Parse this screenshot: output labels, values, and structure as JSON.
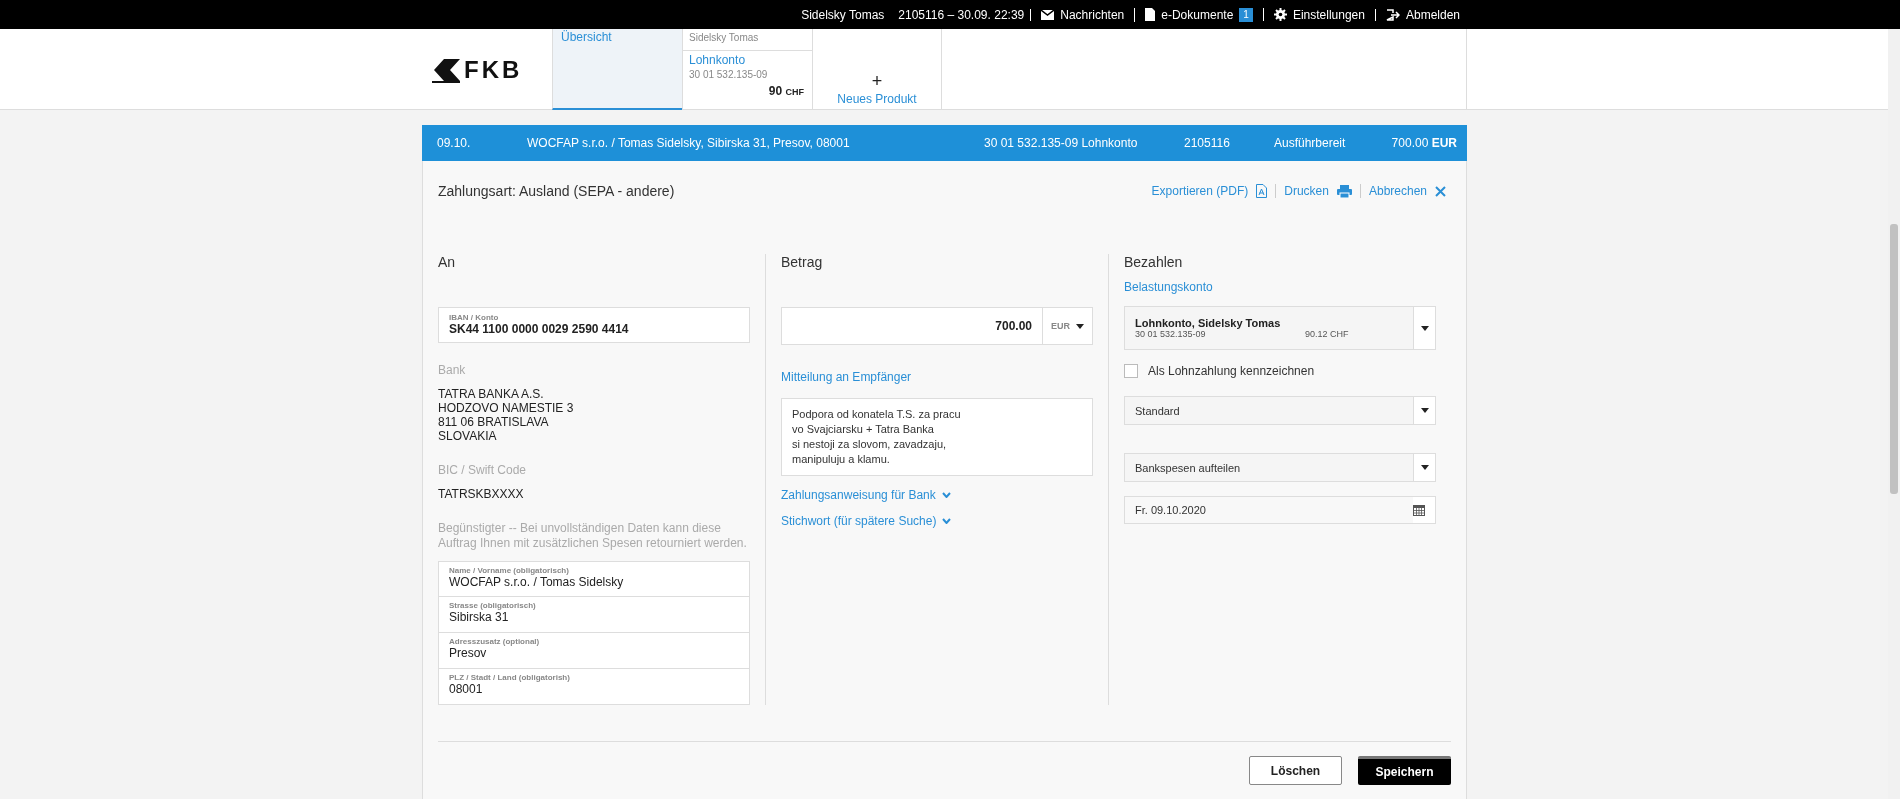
{
  "top_bar": {
    "user": "Sidelsky Tomas",
    "session": "2105116 – 30.09. 22:39",
    "links": [
      {
        "kind": "mail",
        "label": "Nachrichten"
      },
      {
        "kind": "doc",
        "label": "e-Dokumente",
        "badge": "1"
      },
      {
        "kind": "gear",
        "label": "Einstellungen"
      },
      {
        "kind": "logout",
        "label": "Abmelden"
      }
    ]
  },
  "header": {
    "logo": "FKB",
    "tabs": [
      {
        "kind": "overview",
        "label": "Übersicht",
        "selected": true
      },
      {
        "kind": "account",
        "owner": "Sidelsky Tomas",
        "label": "Lohnkonto",
        "number": "30 01 532.135-09",
        "amount": "90",
        "currency": "CHF",
        "selected": false
      },
      {
        "kind": "new",
        "icon": "+",
        "label": "Neues Produkt",
        "selected": false
      }
    ]
  },
  "transaction": {
    "date": "09.10.",
    "recipient": "WOCFAP s.r.o. / Tomas Sidelsky, Sibirska 31, Presov, 08001",
    "account": "30 01 532.135-09 Lohnkonto",
    "reference": "2105116",
    "status": "Ausführbereit",
    "amount": "700.00",
    "currency": "EUR"
  },
  "form": {
    "payment_type": "Zahlungsart: Ausland (SEPA - andere)",
    "actions": [
      {
        "kind": "pdf",
        "label": "Exportieren (PDF)"
      },
      {
        "kind": "print",
        "label": "Drucken"
      },
      {
        "kind": "close",
        "label": "Abbrechen"
      }
    ],
    "to": {
      "title": "An",
      "iban": {
        "label": "IBAN / Konto",
        "value": "SK44 1100 0000 0029 2590 4414"
      },
      "bank_label": "Bank",
      "bank_lines": [
        "TATRA BANKA A.S.",
        "HODZOVO NAMESTIE 3",
        "811 06 BRATISLAVA",
        "SLOVAKIA"
      ],
      "bic_label": "BIC / Swift Code",
      "bic": "TATRSKBXXXX",
      "note": "Begünstigter -- Bei unvollständigen Daten kann diese Auftrag Ihnen mit zusätzlichen Spesen retourniert werden.",
      "fields": [
        {
          "label": "Name / Vorname (obligatorisch)",
          "value": "WOCFAP s.r.o. / Tomas Sidelsky"
        },
        {
          "label": "Strasse (obligatorisch)",
          "value": "Sibirska 31"
        },
        {
          "label": "Adresszusatz (optional)",
          "value": "Presov"
        },
        {
          "label": "PLZ / Stadt / Land (obligatorish)",
          "value": "08001"
        }
      ]
    },
    "amount": {
      "title": "Betrag",
      "value": "700.00",
      "currency": "EUR",
      "message_label": "Mitteilung an Empfänger",
      "message": "Podpora od konatela T.S. za pracu\nvo Svajciarsku + Tatra Banka\nsi nestoji za slovom, zavadzaju,\nmanipuluju a klamu.",
      "expanders": [
        {
          "label": "Zahlungsanweisung für Bank",
          "expanded": false
        },
        {
          "label": "Stichwort (für spätere Suche)",
          "expanded": false
        }
      ]
    },
    "pay": {
      "title": "Bezahlen",
      "account_label": "Belastungskonto",
      "account": {
        "name": "Lohnkonto, Sidelsky Tomas",
        "number": "30 01 532.135-09",
        "balance": "90.12 CHF"
      },
      "salary": {
        "label": "Als Lohnzahlung kennzeichnen",
        "checked": false
      },
      "selects": [
        {
          "value": "Standard"
        },
        {
          "value": "Bankspesen aufteilen"
        }
      ],
      "date": "Fr. 09.10.2020"
    }
  },
  "buttons": [
    {
      "kind": "secondary",
      "label": "Löschen"
    },
    {
      "kind": "primary",
      "label": "Speichern"
    }
  ]
}
